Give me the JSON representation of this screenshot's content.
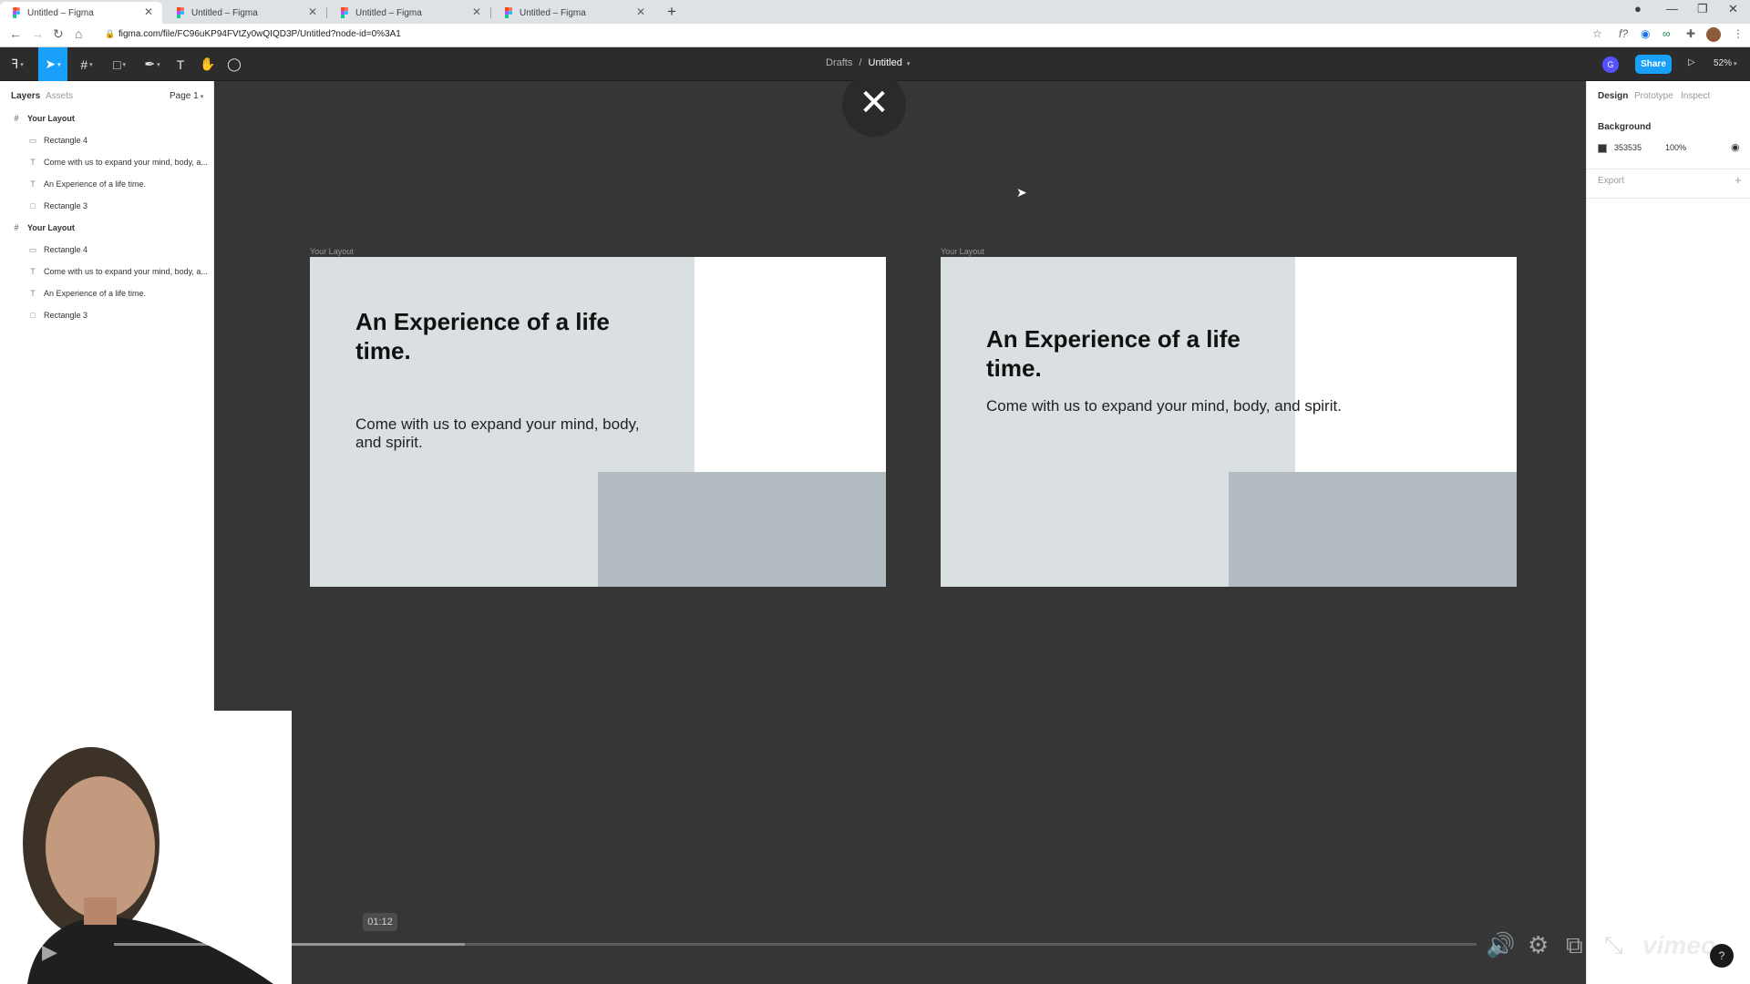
{
  "browser": {
    "tabs": [
      {
        "title": "Untitled – Figma",
        "active": true
      },
      {
        "title": "Untitled – Figma",
        "active": false
      },
      {
        "title": "Untitled – Figma",
        "active": false
      },
      {
        "title": "Untitled – Figma",
        "active": false
      }
    ],
    "url": "figma.com/file/FC96uKP94FVtZy0wQIQD3P/Untitled?node-id=0%3A1"
  },
  "toolbar": {
    "breadcrumb_project": "Drafts",
    "breadcrumb_sep": "/",
    "file_name": "Untitled",
    "user_initial": "G",
    "share_label": "Share",
    "zoom": "52%"
  },
  "left_panel": {
    "tabs": {
      "layers": "Layers",
      "assets": "Assets"
    },
    "page": "Page 1",
    "layers": [
      {
        "name": "Your Layout",
        "type": "frame"
      },
      {
        "name": "Rectangle 4",
        "type": "rect"
      },
      {
        "name": "Come with us to expand your mind, body, a...",
        "type": "text"
      },
      {
        "name": "An Experience of a life time.",
        "type": "text"
      },
      {
        "name": "Rectangle 3",
        "type": "rect"
      },
      {
        "name": "Your Layout",
        "type": "frame"
      },
      {
        "name": "Rectangle 4",
        "type": "rect"
      },
      {
        "name": "Come with us to expand your mind, body, a...",
        "type": "text"
      },
      {
        "name": "An Experience of a life time.",
        "type": "text"
      },
      {
        "name": "Rectangle 3",
        "type": "rect"
      }
    ]
  },
  "canvas": {
    "frames": [
      {
        "label": "Your Layout",
        "heading": "An Experience of a life time.",
        "body": "Come with us to expand your mind, body, and spirit."
      },
      {
        "label": "Your Layout",
        "heading": "An Experience of a life time.",
        "body": "Come with us to expand your mind, body, and spirit."
      }
    ]
  },
  "right_panel": {
    "tabs": {
      "design": "Design",
      "prototype": "Prototype",
      "inspect": "Inspect"
    },
    "background_title": "Background",
    "background_hex": "353535",
    "background_opacity": "100%",
    "export_title": "Export"
  },
  "video": {
    "timestamp": "01:12",
    "brand": "vimeo",
    "progress": 0.2
  },
  "colors": {
    "accent": "#18a0fb",
    "canvas_bg": "#363636",
    "frame_light": "#dadfe2",
    "frame_gray": "#b3bcc1"
  }
}
